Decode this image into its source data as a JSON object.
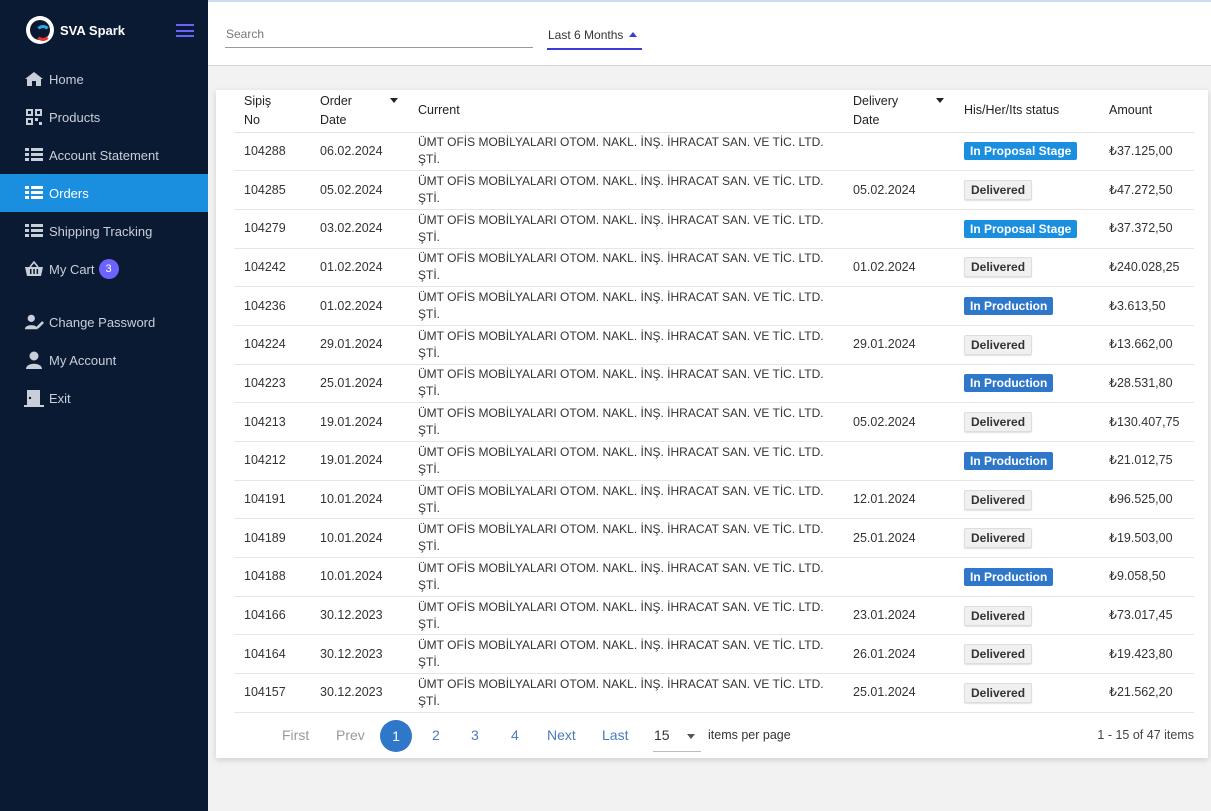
{
  "brand": {
    "name": "SVA Spark"
  },
  "sidebar": {
    "items": [
      {
        "label": "Home",
        "icon": "home-icon"
      },
      {
        "label": "Products",
        "icon": "qr-grid-icon"
      },
      {
        "label": "Account Statement",
        "icon": "list-icon"
      },
      {
        "label": "Orders",
        "icon": "list-icon",
        "active": true
      },
      {
        "label": "Shipping Tracking",
        "icon": "list-icon"
      },
      {
        "label": "My Cart",
        "icon": "basket-icon",
        "badge": "3"
      },
      {
        "label": "Change Password",
        "icon": "user-edit-icon"
      },
      {
        "label": "My Account",
        "icon": "user-icon"
      },
      {
        "label": "Exit",
        "icon": "exit-door-icon"
      }
    ]
  },
  "topbar": {
    "search_placeholder": "Search",
    "period": "Last 6 Months"
  },
  "table": {
    "headers": {
      "no": "Sipiş No",
      "date": "Order Date",
      "current": "Current",
      "delivery": "Delivery Date",
      "status": "His/Her/Its status",
      "amount": "Amount"
    },
    "rows": [
      {
        "no": "104288",
        "date": "06.02.2024",
        "current": "ÜMT OFİS MOBİLYALARI OTOM. NAKL. İNŞ. İHRACAT SAN. VE TİC. LTD. ŞTİ.",
        "delivery": "",
        "status": "In Proposal Stage",
        "amount": "₺37.125,00"
      },
      {
        "no": "104285",
        "date": "05.02.2024",
        "current": "ÜMT OFİS MOBİLYALARI OTOM. NAKL. İNŞ. İHRACAT SAN. VE TİC. LTD. ŞTİ.",
        "delivery": "05.02.2024",
        "status": "Delivered",
        "amount": "₺47.272,50"
      },
      {
        "no": "104279",
        "date": "03.02.2024",
        "current": "ÜMT OFİS MOBİLYALARI OTOM. NAKL. İNŞ. İHRACAT SAN. VE TİC. LTD. ŞTİ.",
        "delivery": "",
        "status": "In Proposal Stage",
        "amount": "₺37.372,50"
      },
      {
        "no": "104242",
        "date": "01.02.2024",
        "current": "ÜMT OFİS MOBİLYALARI OTOM. NAKL. İNŞ. İHRACAT SAN. VE TİC. LTD. ŞTİ.",
        "delivery": "01.02.2024",
        "status": "Delivered",
        "amount": "₺240.028,25"
      },
      {
        "no": "104236",
        "date": "01.02.2024",
        "current": "ÜMT OFİS MOBİLYALARI OTOM. NAKL. İNŞ. İHRACAT SAN. VE TİC. LTD. ŞTİ.",
        "delivery": "",
        "status": "In Production",
        "amount": "₺3.613,50"
      },
      {
        "no": "104224",
        "date": "29.01.2024",
        "current": "ÜMT OFİS MOBİLYALARI OTOM. NAKL. İNŞ. İHRACAT SAN. VE TİC. LTD. ŞTİ.",
        "delivery": "29.01.2024",
        "status": "Delivered",
        "amount": "₺13.662,00"
      },
      {
        "no": "104223",
        "date": "25.01.2024",
        "current": "ÜMT OFİS MOBİLYALARI OTOM. NAKL. İNŞ. İHRACAT SAN. VE TİC. LTD. ŞTİ.",
        "delivery": "",
        "status": "In Production",
        "amount": "₺28.531,80"
      },
      {
        "no": "104213",
        "date": "19.01.2024",
        "current": "ÜMT OFİS MOBİLYALARI OTOM. NAKL. İNŞ. İHRACAT SAN. VE TİC. LTD. ŞTİ.",
        "delivery": "05.02.2024",
        "status": "Delivered",
        "amount": "₺130.407,75"
      },
      {
        "no": "104212",
        "date": "19.01.2024",
        "current": "ÜMT OFİS MOBİLYALARI OTOM. NAKL. İNŞ. İHRACAT SAN. VE TİC. LTD. ŞTİ.",
        "delivery": "",
        "status": "In Production",
        "amount": "₺21.012,75"
      },
      {
        "no": "104191",
        "date": "10.01.2024",
        "current": "ÜMT OFİS MOBİLYALARI OTOM. NAKL. İNŞ. İHRACAT SAN. VE TİC. LTD. ŞTİ.",
        "delivery": "12.01.2024",
        "status": "Delivered",
        "amount": "₺96.525,00"
      },
      {
        "no": "104189",
        "date": "10.01.2024",
        "current": "ÜMT OFİS MOBİLYALARI OTOM. NAKL. İNŞ. İHRACAT SAN. VE TİC. LTD. ŞTİ.",
        "delivery": "25.01.2024",
        "status": "Delivered",
        "amount": "₺19.503,00"
      },
      {
        "no": "104188",
        "date": "10.01.2024",
        "current": "ÜMT OFİS MOBİLYALARI OTOM. NAKL. İNŞ. İHRACAT SAN. VE TİC. LTD. ŞTİ.",
        "delivery": "",
        "status": "In Production",
        "amount": "₺9.058,50"
      },
      {
        "no": "104166",
        "date": "30.12.2023",
        "current": "ÜMT OFİS MOBİLYALARI OTOM. NAKL. İNŞ. İHRACAT SAN. VE TİC. LTD. ŞTİ.",
        "delivery": "23.01.2024",
        "status": "Delivered",
        "amount": "₺73.017,45"
      },
      {
        "no": "104164",
        "date": "30.12.2023",
        "current": "ÜMT OFİS MOBİLYALARI OTOM. NAKL. İNŞ. İHRACAT SAN. VE TİC. LTD. ŞTİ.",
        "delivery": "26.01.2024",
        "status": "Delivered",
        "amount": "₺19.423,80"
      },
      {
        "no": "104157",
        "date": "30.12.2023",
        "current": "ÜMT OFİS MOBİLYALARI OTOM. NAKL. İNŞ. İHRACAT SAN. VE TİC. LTD. ŞTİ.",
        "delivery": "25.01.2024",
        "status": "Delivered",
        "amount": "₺21.562,20"
      }
    ]
  },
  "pager": {
    "first": "First",
    "prev": "Prev",
    "pages": [
      "1",
      "2",
      "3",
      "4"
    ],
    "current": "1",
    "next": "Next",
    "last": "Last",
    "per_page": "15",
    "per_page_label": "items per page",
    "range": "1 - 15 of 47 items"
  },
  "colors": {
    "sidebar_bg": "#0b1a33",
    "active": "#1a8fe0",
    "proposal": "#1a8fe0",
    "production": "#2f77c9",
    "accent": "#6c63ff"
  }
}
